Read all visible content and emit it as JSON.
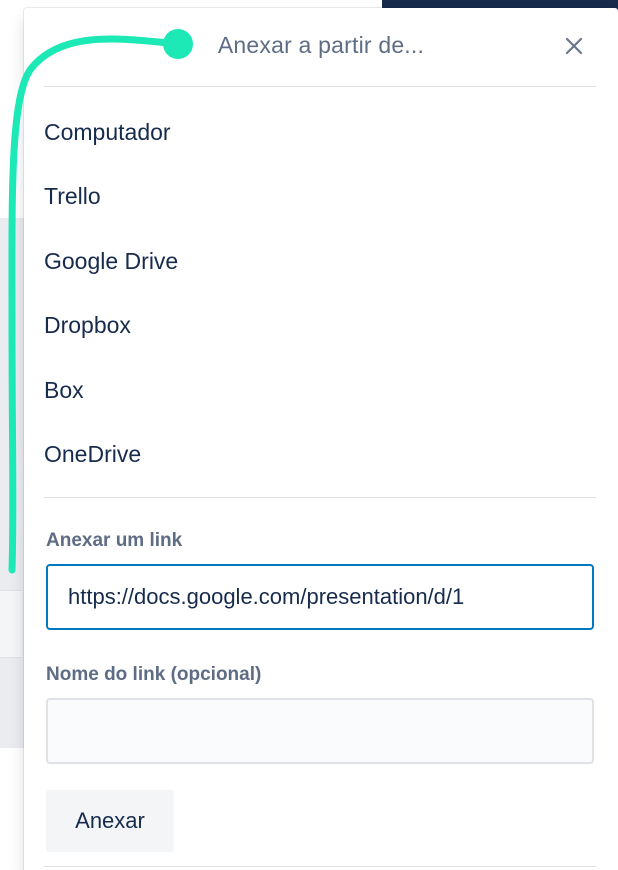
{
  "popover": {
    "title": "Anexar a partir de...",
    "close_icon": "close-icon"
  },
  "sources": [
    {
      "label": "Computador"
    },
    {
      "label": "Trello"
    },
    {
      "label": "Google Drive"
    },
    {
      "label": "Dropbox"
    },
    {
      "label": "Box"
    },
    {
      "label": "OneDrive"
    }
  ],
  "link": {
    "section_label": "Anexar um link",
    "url_value": "https://docs.google.com/presentation/d/1",
    "name_label": "Nome do link (opcional)",
    "name_value": "",
    "attach_label": "Anexar"
  },
  "colors": {
    "annotation": "#1de9b6",
    "focus_border": "#0079bf",
    "text": "#172b4d",
    "muted": "#5e6c84"
  }
}
